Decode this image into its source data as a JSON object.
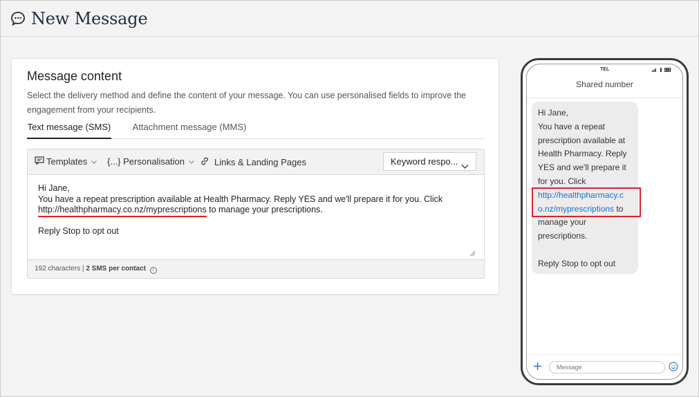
{
  "header": {
    "title": "New Message"
  },
  "content": {
    "title": "Message content",
    "description": "Select the delivery method and define the content of your message. You can use personalised fields to improve the engagement from your recipients.",
    "tabs": [
      {
        "label": "Text message (SMS)",
        "active": true
      },
      {
        "label": "Attachment message (MMS)",
        "active": false
      }
    ],
    "toolbar": {
      "templates_label": "Templates",
      "personalisation_label": "{...} Personalisation",
      "links_label": "Links & Landing Pages",
      "keyword_label": "Keyword respo..."
    },
    "message": {
      "line1": "Hi Jane,",
      "line2": "You have a repeat prescription available at Health Pharmacy. Reply YES and we'll prepare it for you. Click",
      "link": "http://healthpharmacy.co.nz/myprescriptions",
      "line3_suffix": " to manage your prescriptions.",
      "line4": "Reply Stop to opt out"
    },
    "footer": {
      "characters": "192 characters",
      "sms_count": "2 SMS per contact"
    }
  },
  "phone": {
    "carrier": "TEL",
    "header": "Shared number",
    "bubble": {
      "l1": "Hi Jane,",
      "l2": "You have a repeat",
      "l3": "prescription available at",
      "l4": "Health Pharmacy. Reply",
      "l5": "YES and we'll prepare it",
      "l6": "for you. Click",
      "link_a": "http://healthpharmacy.c",
      "link_b": "o.nz/myprescriptions",
      "after_link": " to",
      "l8": "manage your",
      "l9": "prescriptions.",
      "l10": "Reply Stop to opt out"
    },
    "input_placeholder": "Message"
  },
  "colors": {
    "link": "#1a6fd1",
    "highlight": "#d9232d",
    "underline": "#e02020"
  }
}
